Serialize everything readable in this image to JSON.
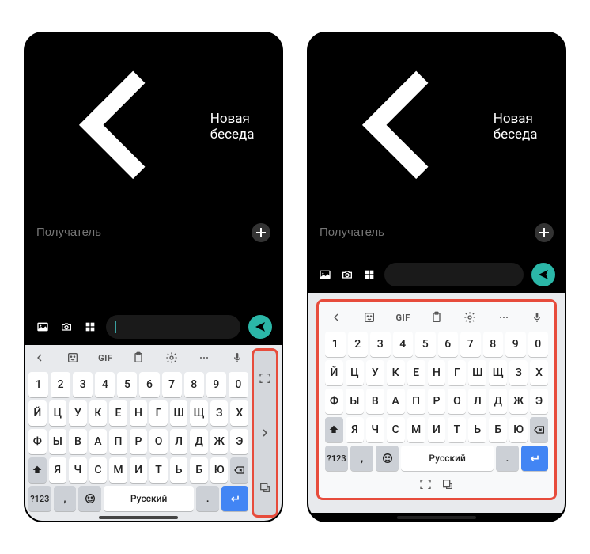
{
  "header": {
    "title": "Новая беседа"
  },
  "recipient": {
    "placeholder": "Получатель"
  },
  "keyboard": {
    "toolbar": {
      "gif": "GIF"
    },
    "rows": {
      "numbers": [
        "1",
        "2",
        "3",
        "4",
        "5",
        "6",
        "7",
        "8",
        "9",
        "0"
      ],
      "row1": [
        "Й",
        "Ц",
        "У",
        "К",
        "Е",
        "Н",
        "Г",
        "Ш",
        "Щ",
        "З",
        "Х"
      ],
      "row2": [
        "Ф",
        "Ы",
        "В",
        "А",
        "П",
        "Р",
        "О",
        "Л",
        "Д",
        "Ж",
        "Э"
      ],
      "row3": [
        "Я",
        "Ч",
        "С",
        "М",
        "И",
        "Т",
        "Ь",
        "Б",
        "Ю"
      ]
    },
    "bottom": {
      "symbols": "?123",
      "comma": ",",
      "space": "Русский",
      "period": "."
    }
  }
}
